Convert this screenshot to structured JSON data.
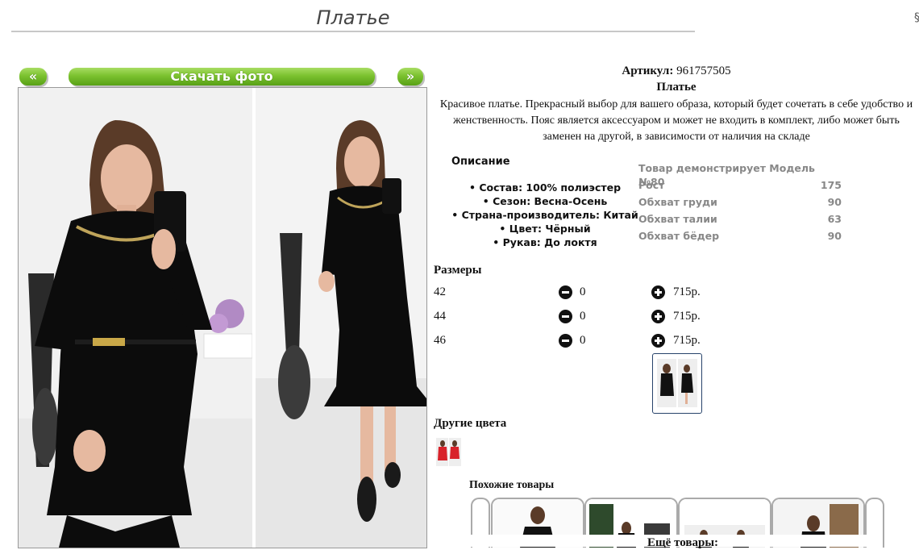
{
  "product": {
    "page_title": "Платье",
    "edge_mark": "§",
    "prev_label": "«",
    "next_label": "»",
    "download_label": "Скачать фото",
    "article_label": "Артикул:",
    "article_value": "961757505",
    "name": "Платье",
    "description": "Красивое платье. Прекрасный выбор для вашего образа, который будет сочетать в себе удобство и женственность. Пояс является аксессуаром и может не входить в комплект, либо может быть заменен на другой, в зависимости от наличия на складе"
  },
  "details": {
    "title": "Описание",
    "items": [
      "Состав: 100% полиэстер",
      "Сезон: Весна-Осень",
      "Страна-производитель: Китай",
      "Цвет: Чёрный",
      "Рукав: До локтя"
    ]
  },
  "model": {
    "heading": "Товар демонстрирует Модель №80",
    "rows": [
      {
        "label": "Рост",
        "value": "175"
      },
      {
        "label": "Обхват груди",
        "value": "90"
      },
      {
        "label": "Обхват талии",
        "value": "63"
      },
      {
        "label": "Обхват бёдер",
        "value": "90"
      }
    ]
  },
  "sizes": {
    "title": "Размеры",
    "rows": [
      {
        "size": "42",
        "qty": "0",
        "price": "715р."
      },
      {
        "size": "44",
        "qty": "0",
        "price": "715р."
      },
      {
        "size": "46",
        "qty": "0",
        "price": "715р."
      }
    ]
  },
  "other_colors": {
    "title": "Другие цвета"
  },
  "similar": {
    "title": "Похожие товары",
    "more_title": "Ещё товары:"
  },
  "colors": {
    "accent_green": "#7cc22f",
    "thumb_border": "#27436b",
    "muted_text": "#888888"
  }
}
